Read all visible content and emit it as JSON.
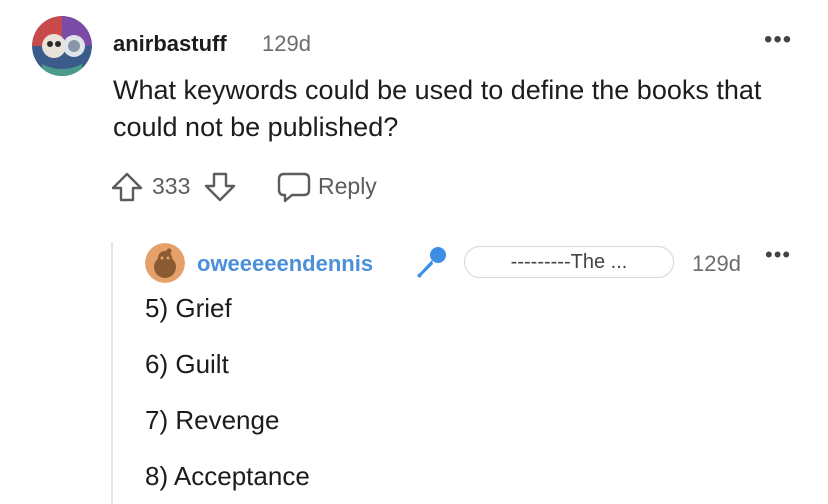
{
  "parent_comment": {
    "author": "anirbastuff",
    "age": "129d",
    "more_glyph": "•••",
    "body": "What keywords could be used to define the books that could not be published?",
    "score": "333",
    "reply_label": "Reply"
  },
  "reply_comment": {
    "author": "oweeeeendennis",
    "flair": "---------The ...",
    "age": "129d",
    "more_glyph": "•••",
    "lines": [
      "5) Grief",
      "6) Guilt",
      "7) Revenge",
      "8) Acceptance"
    ]
  },
  "colors": {
    "username_reply": "#4a8fd8",
    "mic": "#3a8ee6",
    "muted_text": "#6a6c6e",
    "thread_line": "#e4e6e8"
  },
  "icons": {
    "upvote": "arrow-up-outline-icon",
    "downvote": "arrow-down-outline-icon",
    "reply": "speech-bubble-icon",
    "flair": "microphone-icon"
  }
}
